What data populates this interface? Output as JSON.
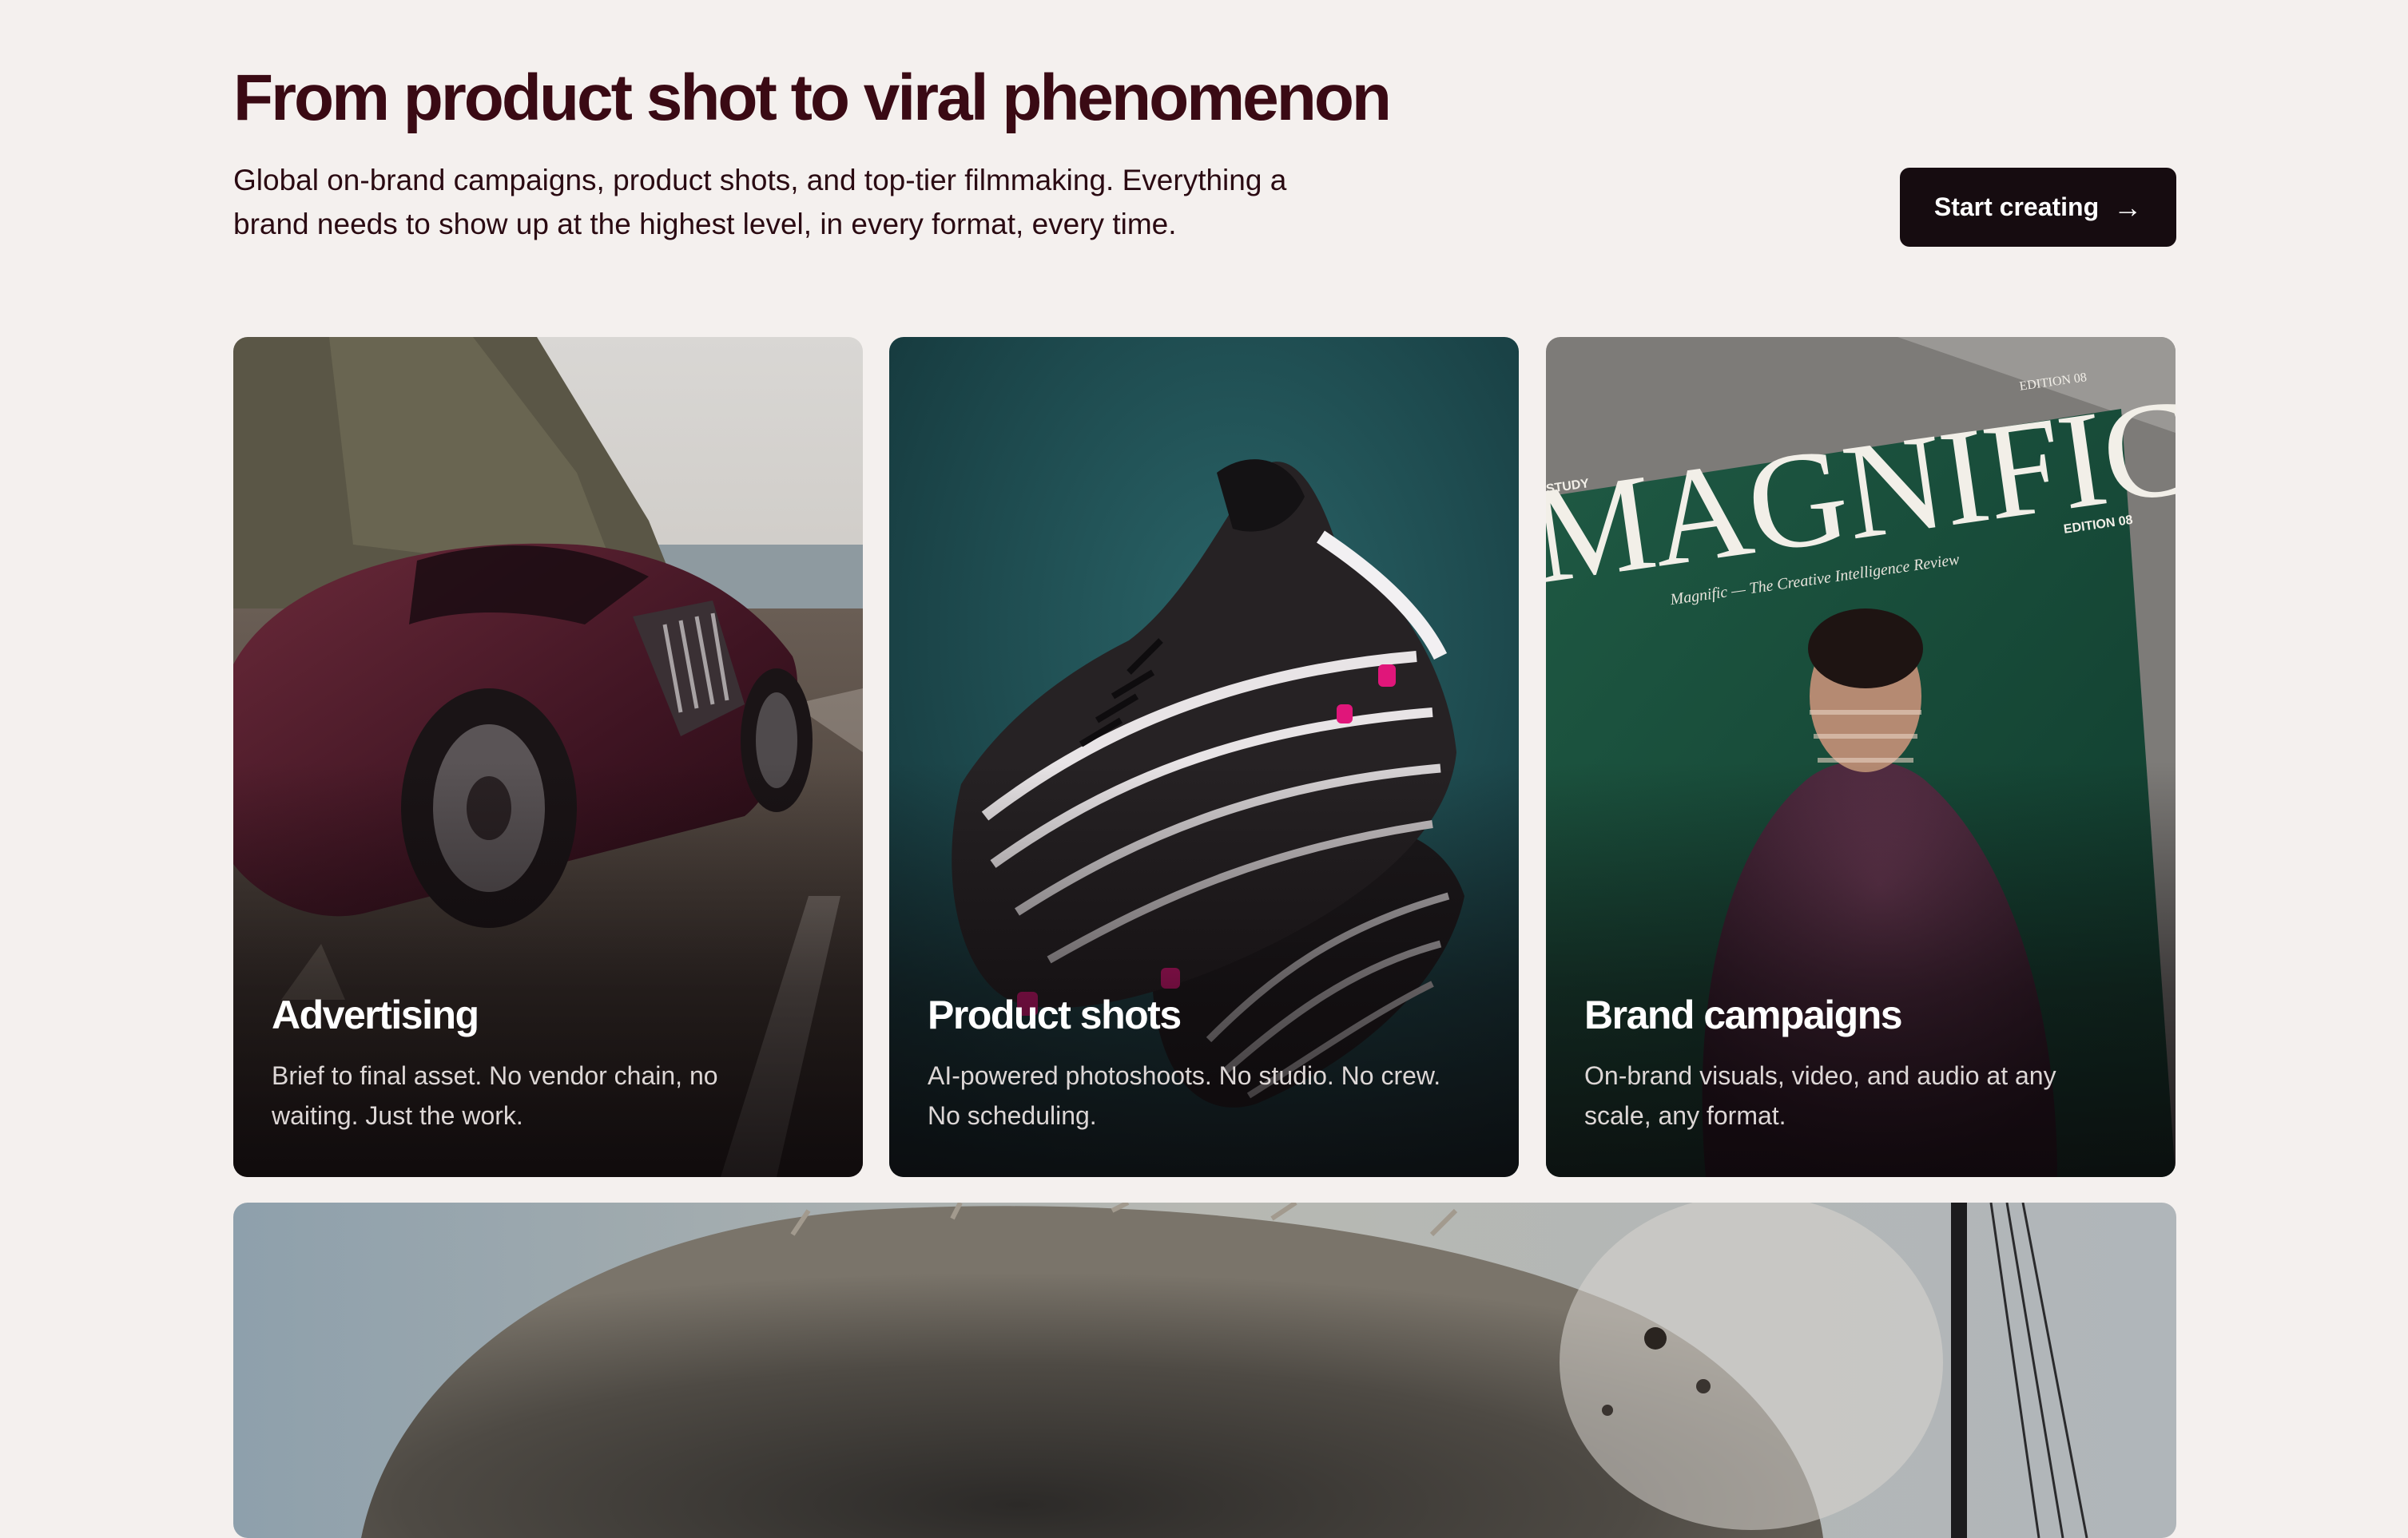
{
  "hero": {
    "title": "From product shot to viral phenomenon",
    "subtitle_line1": "Global on-brand campaigns, product shots, and top-tier filmmaking. Everything a",
    "subtitle_line2": "brand needs to show up at the highest level, in every format, every time.",
    "cta_label": "Start creating",
    "cta_icon": "arrow-right-icon"
  },
  "cards": [
    {
      "title": "Advertising",
      "description_line1": "Brief to final asset. No vendor chain, no",
      "description_line2": "waiting. Just the work.",
      "image": "sports-car-on-coastal-road"
    },
    {
      "title": "Product shots",
      "description_line1": "AI-powered photoshoots. No studio. No crew.",
      "description_line2": "No scheduling.",
      "image": "black-football-boots-on-teal"
    },
    {
      "title": "Brand campaigns",
      "description_line1": "On-brand visuals, video, and audio at any",
      "description_line2": "scale, any format.",
      "image": "magazine-cover",
      "magazine": {
        "masthead": "MAGNIFIC",
        "edition_top": "EDITION 08",
        "edition_side": "EDITION 08",
        "study": "A STUDY",
        "tagline": "Magnific — The Creative Intelligence Review"
      }
    }
  ],
  "banner": {
    "image": "furry-creature-closeup-with-dust"
  },
  "colors": {
    "background": "#f4f0ee",
    "title": "#3a0a14",
    "cta_bg": "#160c10"
  }
}
